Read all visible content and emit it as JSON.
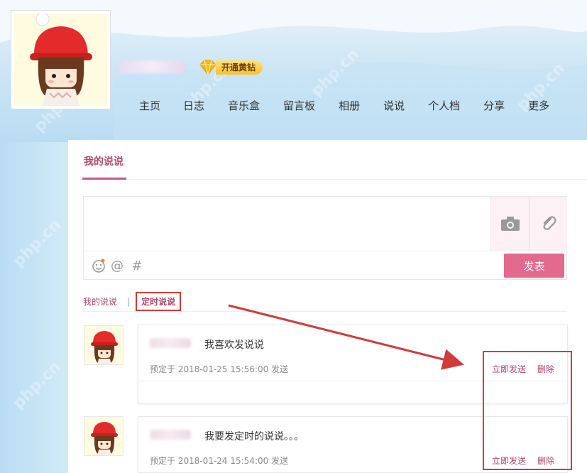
{
  "header": {
    "vip_badge_label": "开通黄钻"
  },
  "nav": {
    "items": [
      "主页",
      "日志",
      "音乐盒",
      "留言板",
      "相册",
      "说说",
      "个人档",
      "分享",
      "更多"
    ]
  },
  "panel": {
    "tab_label": "我的说说",
    "composer": {
      "placeholder": "",
      "post_button": "发表",
      "emoji_symbol": "☺",
      "at_symbol": "@",
      "hash_symbol": "#"
    },
    "subtabs": {
      "mine": "我的说说",
      "separator": "|",
      "timed": "定时说说"
    }
  },
  "feed": [
    {
      "content": "我喜欢发说说",
      "schedule": "预定于 2018-01-25 15:56:00 发送",
      "send_now": "立即发送",
      "delete": "删除"
    },
    {
      "content": "我要发定时的说说。。。",
      "schedule": "预定于 2018-01-24 15:54:00 发送",
      "send_now": "立即发送",
      "delete": "删除"
    }
  ],
  "watermark": "php.cn",
  "colors": {
    "accent": "#b3456a",
    "post_button": "#e3698e",
    "highlight": "#d33a3a",
    "sky": "#cfe7f6"
  },
  "icons": [
    "camera-icon",
    "link-icon",
    "emoji-icon",
    "at-icon",
    "hash-icon",
    "diamond-icon"
  ]
}
